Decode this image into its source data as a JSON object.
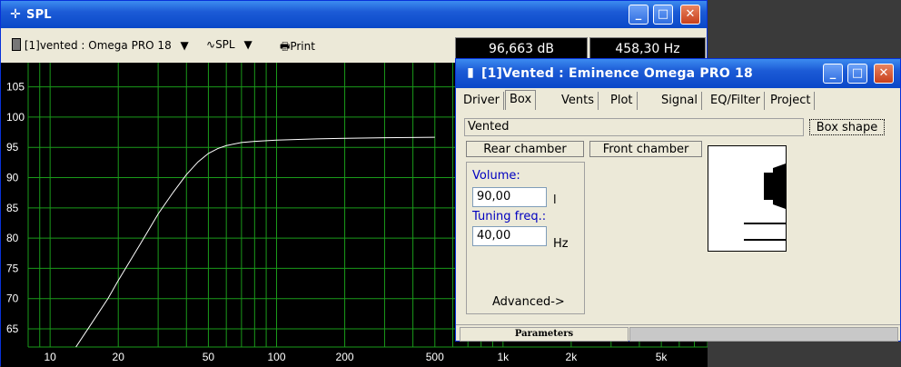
{
  "spl_window": {
    "title": "SPL",
    "driver_select": "[1]vented : Omega PRO 18",
    "view_select": "SPL",
    "print_label": "Print",
    "readout_db": "96,663 dB",
    "readout_hz": "458,30 Hz"
  },
  "chart_data": {
    "type": "line",
    "y_ticks": [
      "105",
      "100",
      "95",
      "90",
      "85",
      "80",
      "75",
      "70",
      "65"
    ],
    "x_ticks": [
      "10",
      "20",
      "50",
      "100",
      "200",
      "500",
      "1k",
      "2k",
      "5k"
    ],
    "x_scale": "log",
    "xlim": [
      8,
      8000
    ],
    "ylim": [
      62,
      109
    ],
    "grid": true,
    "colors": {
      "background": "#000000",
      "grid": "#1a9a1a",
      "line": "#ffffff"
    },
    "series": [
      {
        "x": [
          13,
          15,
          18,
          20,
          25,
          30,
          35,
          40,
          45,
          50,
          55,
          60,
          70,
          80,
          100,
          150,
          200,
          300,
          500
        ],
        "y": [
          62,
          65.5,
          70,
          73,
          79,
          84,
          87.6,
          90.5,
          92.6,
          94,
          94.8,
          95.3,
          95.8,
          96.0,
          96.2,
          96.4,
          96.5,
          96.6,
          96.66
        ]
      }
    ]
  },
  "params_window": {
    "title": "[1]Vented : Eminence  Omega PRO 18",
    "tabs": [
      "Driver",
      "Box",
      "Vents",
      "Plot",
      "Signal",
      "EQ/Filter",
      "Project"
    ],
    "active_tab": "Box",
    "box_type": "Vented",
    "box_shape_label": "Box shape",
    "rear_chamber_label": "Rear chamber",
    "front_chamber_label": "Front chamber",
    "volume_label": "Volume:",
    "volume_value": "90,00",
    "volume_unit": "l",
    "tuning_label": "Tuning freq.:",
    "tuning_value": "40,00",
    "tuning_unit": "Hz",
    "advanced_label": "Advanced->",
    "status_label": "Parameters"
  }
}
